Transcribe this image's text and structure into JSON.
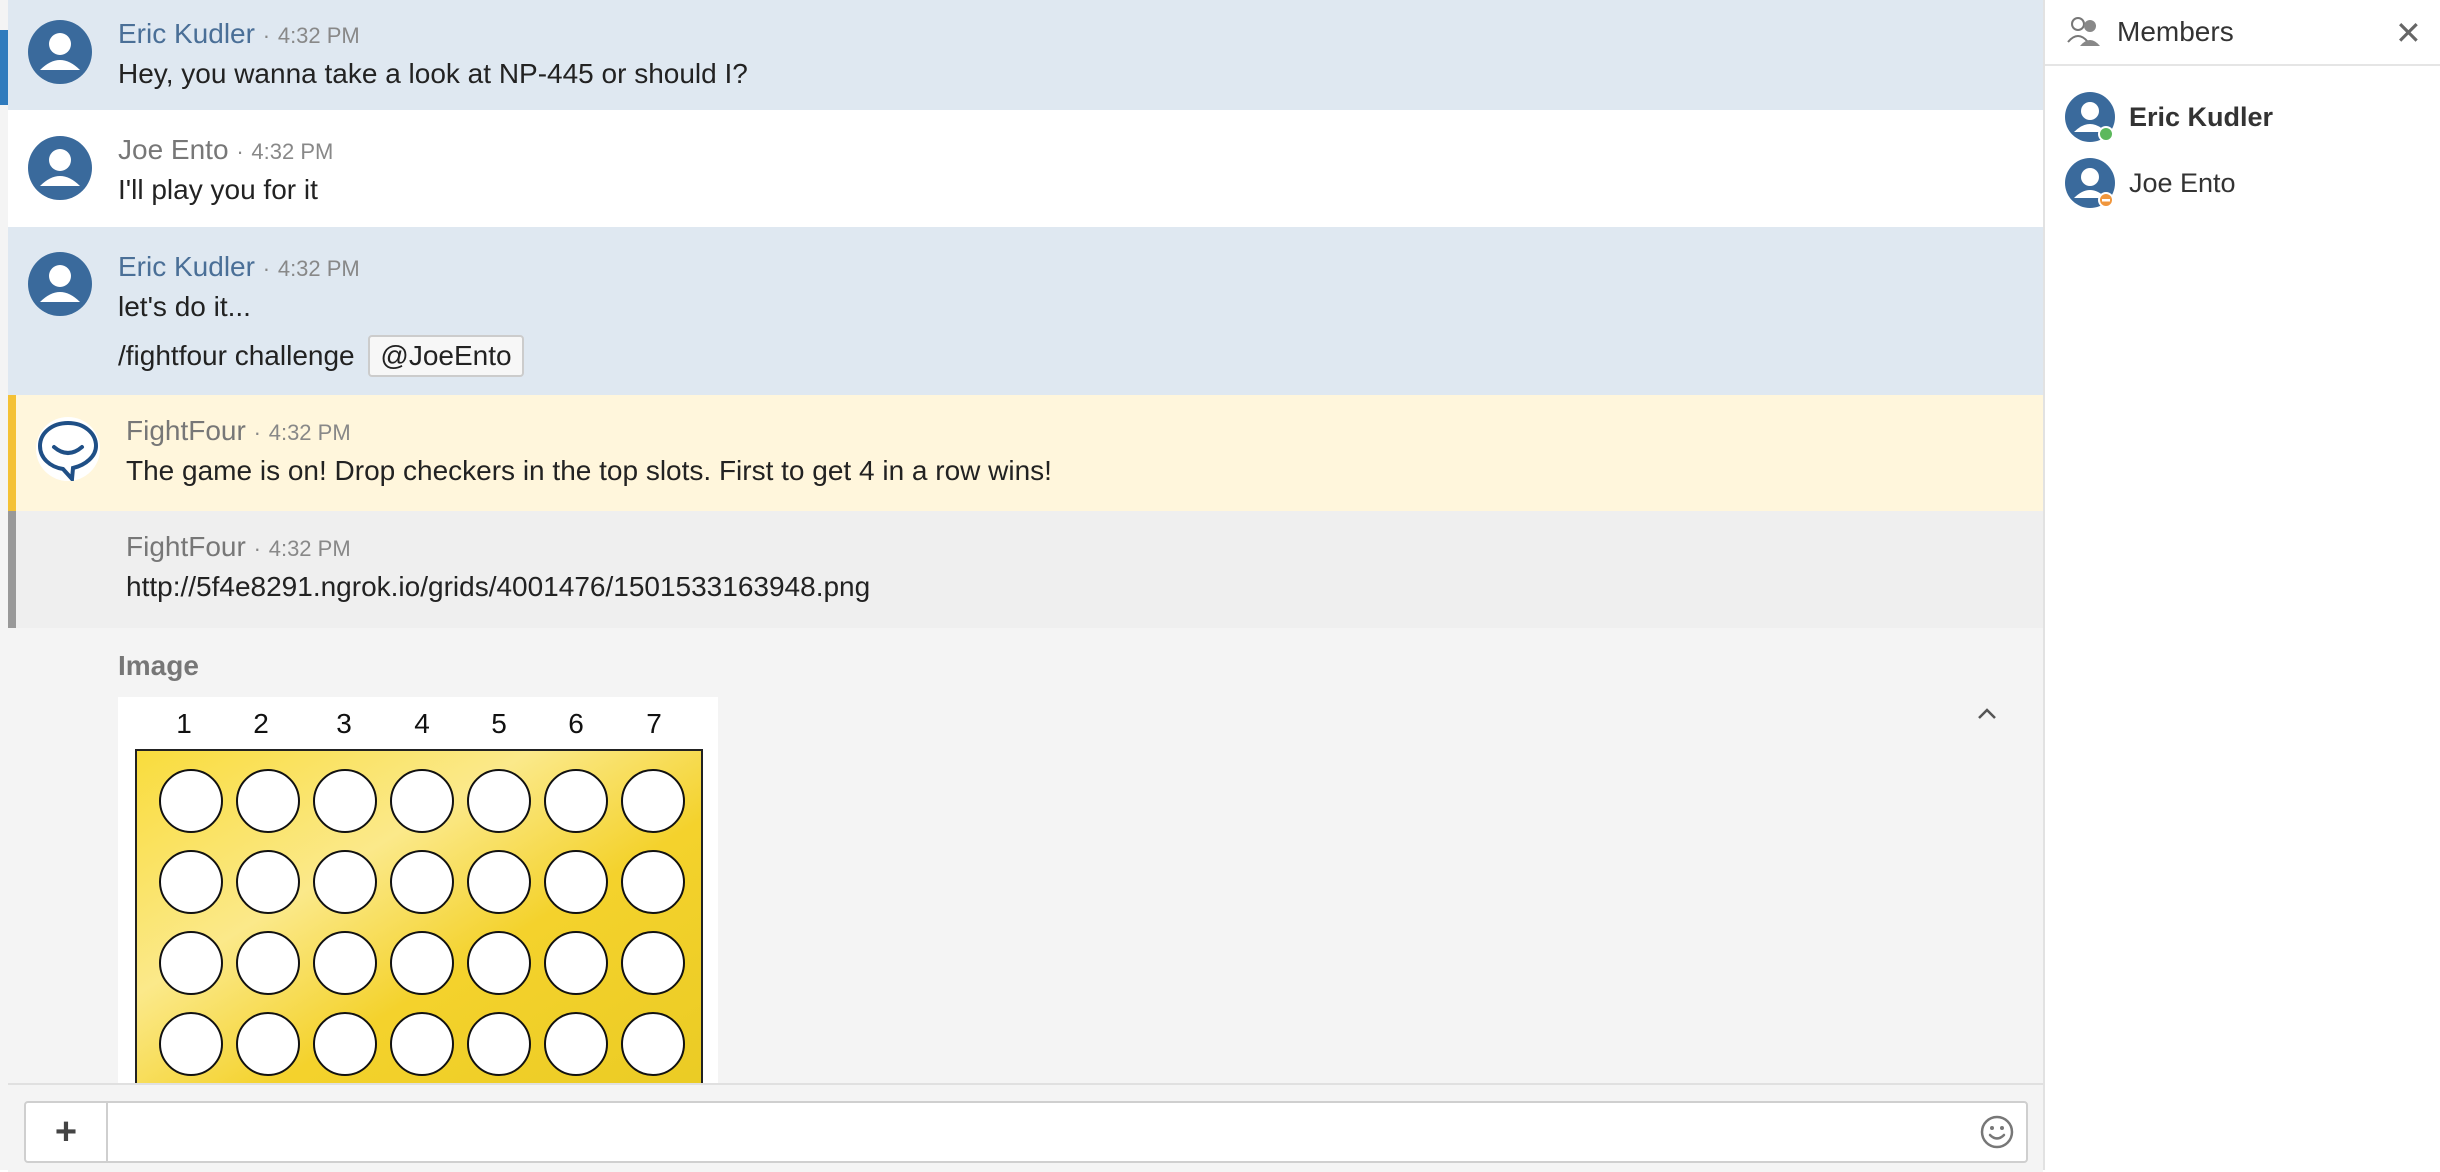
{
  "messages": [
    {
      "name": "Eric Kudler",
      "time": "4:32 PM",
      "text": "Hey, you wanna take a look at NP-445 or should I?"
    },
    {
      "name": "Joe Ento",
      "time": "4:32 PM",
      "text": "I'll play you for it"
    },
    {
      "name": "Eric Kudler",
      "time": "4:32 PM",
      "text": "let's do it...",
      "text2": "/fightfour challenge",
      "mention": "@JoeEnto"
    },
    {
      "name": "FightFour",
      "time": "4:32 PM",
      "text": "The game is on! Drop checkers in the top slots. First to get 4 in a row wins!"
    },
    {
      "name": "FightFour",
      "time": "4:32 PM",
      "link": "http://5f4e8291.ngrok.io/grids/4001476/1501533163948.png"
    }
  ],
  "separator": "·",
  "image": {
    "label": "Image",
    "columns": [
      "1",
      "2",
      "3",
      "4",
      "5",
      "6",
      "7"
    ],
    "collapse_icon": "chevron-up-icon"
  },
  "composer": {
    "plus": "+",
    "emoji_icon": "smiley-icon"
  },
  "members": {
    "title": "Members",
    "close": "✕",
    "list": [
      {
        "name": "Eric Kudler",
        "status": "online",
        "status_color": "#5cb85c"
      },
      {
        "name": "Joe Ento",
        "status": "busy",
        "status_color": "#f0963c"
      }
    ]
  },
  "colors": {
    "accent": "#2f7bbd",
    "bot_bar": "#f4c135",
    "board": "#f6d32d"
  }
}
